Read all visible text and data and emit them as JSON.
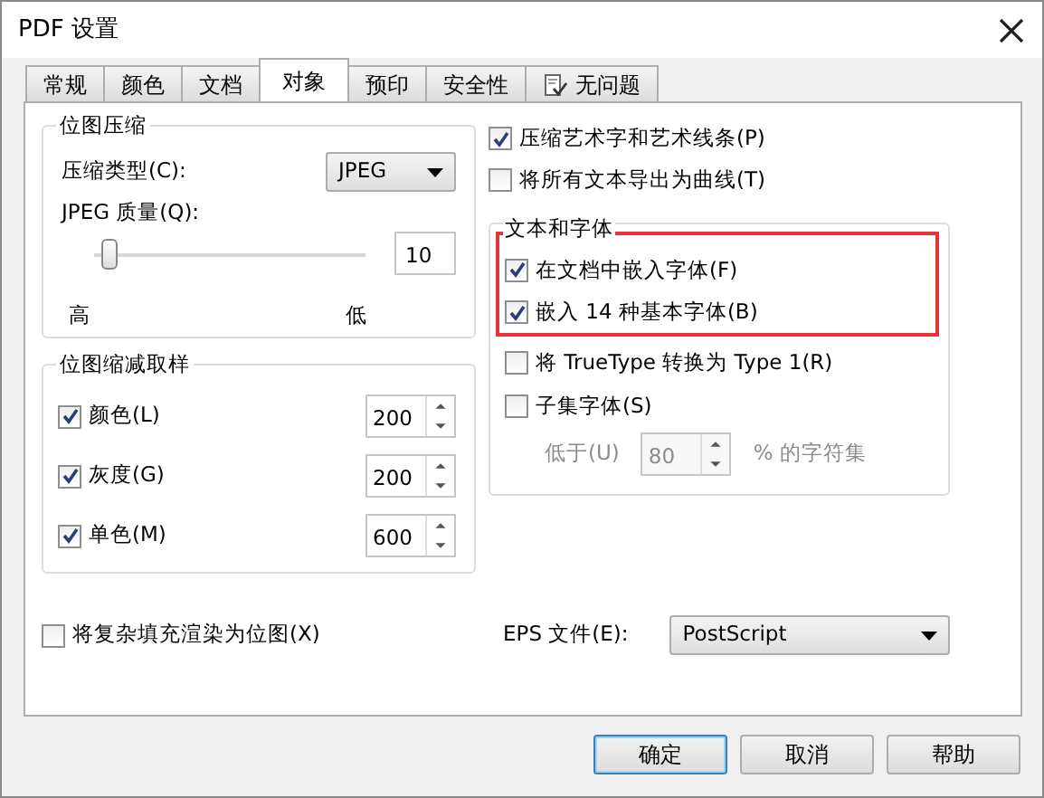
{
  "window": {
    "title": "PDF 设置"
  },
  "tabs": [
    {
      "label": "常规",
      "selected": false,
      "icon": false
    },
    {
      "label": "颜色",
      "selected": false,
      "icon": false
    },
    {
      "label": "文档",
      "selected": false,
      "icon": false
    },
    {
      "label": "对象",
      "selected": true,
      "icon": false
    },
    {
      "label": "预印",
      "selected": false,
      "icon": false
    },
    {
      "label": "安全性",
      "selected": false,
      "icon": false
    },
    {
      "label": "无问题",
      "selected": false,
      "icon": true
    }
  ],
  "bitmap_compression": {
    "title": "位图压缩",
    "type_label": "压缩类型(C):",
    "type_value": "JPEG",
    "quality_label": "JPEG 质量(Q):",
    "quality": {
      "level": 0.05,
      "value": "10"
    },
    "high_label": "高",
    "low_label": "低"
  },
  "downsampling": {
    "title": "位图缩减取样",
    "rows": [
      {
        "label": "颜色(L)",
        "checked": true,
        "value": "200"
      },
      {
        "label": "灰度(G)",
        "checked": true,
        "value": "200"
      },
      {
        "label": "单色(M)",
        "checked": true,
        "value": "600"
      }
    ]
  },
  "options": [
    {
      "label": "压缩艺术字和艺术线条(P)",
      "checked": true
    },
    {
      "label": "将所有文本导出为曲线(T)",
      "checked": false
    }
  ],
  "text_fonts": {
    "title": "文本和字体",
    "highlighted": true,
    "options": [
      {
        "label": "在文档中嵌入字体(F)",
        "checked": true,
        "highlighted": true
      },
      {
        "label": "嵌入 14 种基本字体(B)",
        "checked": true,
        "highlighted": true
      },
      {
        "label": "将 TrueType 转换为 Type 1(R)",
        "checked": false,
        "highlighted": false
      },
      {
        "label": "子集字体(S)",
        "checked": false,
        "highlighted": false
      }
    ],
    "subset": {
      "label": "低于(U)",
      "value": "80",
      "suffix": "% 的字符集",
      "disabled": true
    }
  },
  "render_bitmap": {
    "label": "将复杂填充渲染为位图(X)",
    "checked": false
  },
  "eps": {
    "label": "EPS 文件(E):",
    "value": "PostScript"
  },
  "buttons": [
    {
      "label": "确定",
      "default": true
    },
    {
      "label": "取消",
      "default": false
    },
    {
      "label": "帮助",
      "default": false
    }
  ]
}
